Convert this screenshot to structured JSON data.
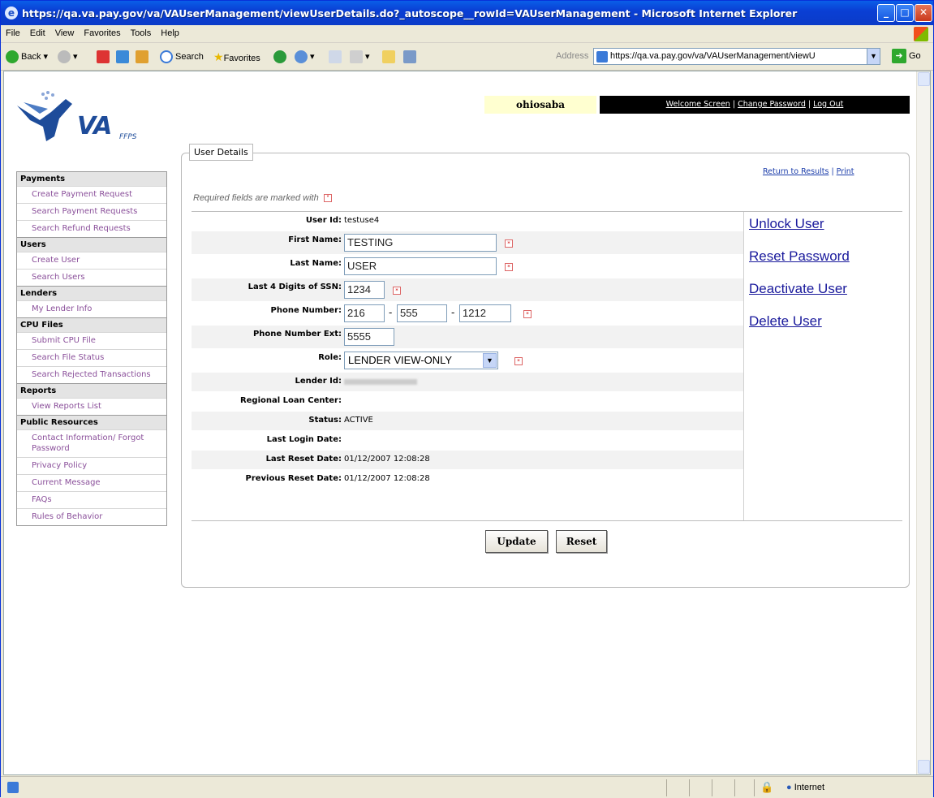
{
  "window": {
    "title": "https://qa.va.pay.gov/va/VAUserManagement/viewUserDetails.do?_autoscope__rowId=VAUserManagement - Microsoft Internet Explorer"
  },
  "menu": [
    "File",
    "Edit",
    "View",
    "Favorites",
    "Tools",
    "Help"
  ],
  "toolbar": {
    "back": "Back",
    "search": "Search",
    "favorites": "Favorites",
    "address_label": "Address",
    "address": "https://qa.va.pay.gov/va/VAUserManagement/viewU",
    "go": "Go"
  },
  "logo": {
    "text": "VA",
    "sub": "FFPS"
  },
  "nav": [
    {
      "section": "Payments",
      "items": [
        "Create Payment Request",
        "Search Payment Requests",
        "Search Refund Requests"
      ]
    },
    {
      "section": "Users",
      "items": [
        "Create User",
        "Search Users"
      ]
    },
    {
      "section": "Lenders",
      "items": [
        "My Lender Info"
      ]
    },
    {
      "section": "CPU Files",
      "items": [
        "Submit CPU File",
        "Search File Status",
        "Search Rejected Transactions"
      ]
    },
    {
      "section": "Reports",
      "items": [
        "View Reports List"
      ]
    },
    {
      "section": "Public Resources",
      "items": [
        "Contact Information/ Forgot Password",
        "Privacy Policy",
        "Current Message",
        "FAQs",
        "Rules of Behavior"
      ]
    }
  ],
  "header": {
    "username": "ohiosaba",
    "welcome": "Welcome Screen",
    "change_password": "Change Password",
    "logout": "Log Out",
    "sep": "|"
  },
  "panel": {
    "legend": "User Details",
    "return_link": "Return to Results",
    "print_link": "Print",
    "required_note": "Required fields are marked with"
  },
  "fields": {
    "user_id_label": "User Id:",
    "user_id": "testuse4",
    "first_name_label": "First Name:",
    "first_name": "TESTING",
    "last_name_label": "Last Name:",
    "last_name": "USER",
    "ssn_label": "Last 4 Digits of SSN:",
    "ssn": "1234",
    "phone_label": "Phone Number:",
    "phone1": "216",
    "phone2": "555",
    "phone3": "1212",
    "ext_label": "Phone Number Ext:",
    "ext": "5555",
    "role_label": "Role:",
    "role": "LENDER VIEW-ONLY",
    "lender_id_label": "Lender Id:",
    "rlc_label": "Regional Loan Center:",
    "status_label": "Status:",
    "status": "ACTIVE",
    "last_login_label": "Last Login Date:",
    "last_reset_label": "Last Reset Date:",
    "last_reset": "01/12/2007 12:08:28",
    "prev_reset_label": "Previous Reset Date:",
    "prev_reset": "01/12/2007 12:08:28"
  },
  "actions": [
    "Unlock User",
    "Reset Password",
    "Deactivate User",
    "Delete User"
  ],
  "buttons": {
    "update": "Update",
    "reset": "Reset"
  },
  "status": {
    "zone": "Internet"
  }
}
